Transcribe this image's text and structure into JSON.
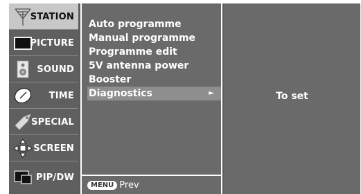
{
  "sidebar": {
    "tabs": [
      {
        "label": "STATION",
        "icon": "antenna-icon",
        "active": true
      },
      {
        "label": "PICTURE",
        "icon": "tv-screen-icon",
        "active": false
      },
      {
        "label": "SOUND",
        "icon": "speaker-icon",
        "active": false
      },
      {
        "label": "TIME",
        "icon": "clock-icon",
        "active": false
      },
      {
        "label": "SPECIAL",
        "icon": "special-tag-icon",
        "active": false
      },
      {
        "label": "SCREEN",
        "icon": "screen-arrows-icon",
        "active": false
      },
      {
        "label": "PIP/DW",
        "icon": "pip-icon",
        "active": false
      }
    ]
  },
  "menu": {
    "items": [
      {
        "label": "Auto programme"
      },
      {
        "label": "Manual programme"
      },
      {
        "label": "Programme edit"
      },
      {
        "label": "5V antenna power"
      },
      {
        "label": "Booster"
      },
      {
        "label": "Diagnostics",
        "selected": true,
        "arrow": "►"
      }
    ],
    "footer": {
      "key_label": "MENU",
      "prev_label": "Prev"
    }
  },
  "detail": {
    "text": "To set"
  },
  "colors": {
    "panel": "#6a6a6a",
    "active_tab": "#c8c8c8",
    "selected_row": "#8e8e8e"
  }
}
